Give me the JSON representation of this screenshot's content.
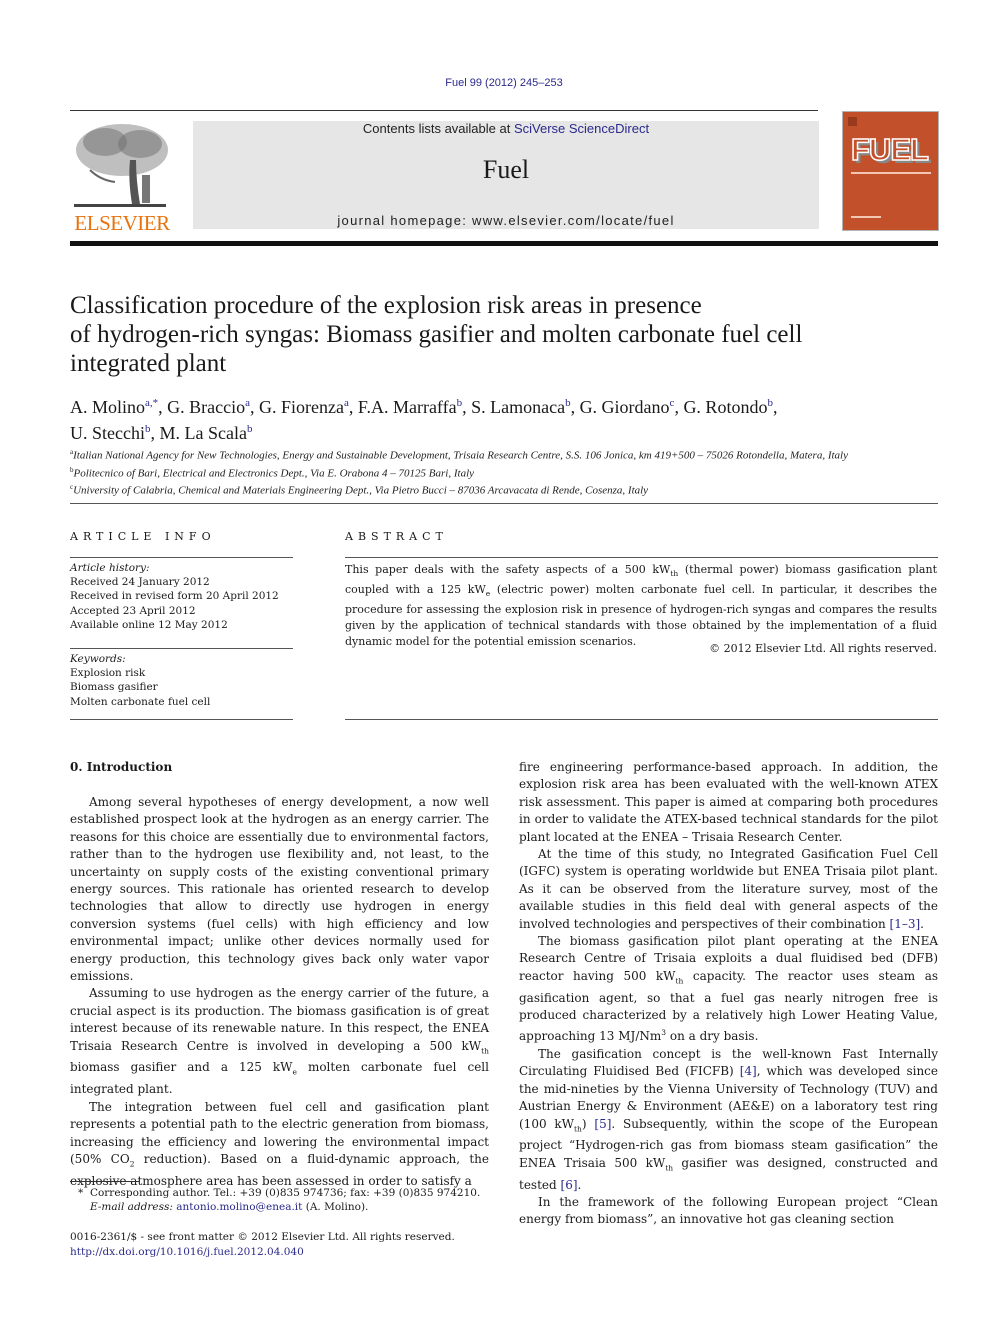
{
  "header": {
    "journal_reference": "Fuel 99 (2012) 245–253",
    "contents_prefix": "Contents lists available at ",
    "contents_link": "SciVerse ScienceDirect",
    "journal_name": "Fuel",
    "homepage": "journal homepage: www.elsevier.com/locate/fuel",
    "publisher_logo_text": "ELSEVIER",
    "cover_title": "FUEL",
    "colors": {
      "elsevier_orange": "#e8730e",
      "cover_orange": "#c2502a",
      "link_blue": "#2a2a8c",
      "masthead_gray": "#e6e6e6"
    }
  },
  "article": {
    "title_lines": [
      "Classification procedure of the explosion risk areas in presence",
      "of hydrogen-rich syngas: Biomass gasifier and molten carbonate fuel cell",
      "integrated plant"
    ],
    "authors": [
      {
        "name": "A. Molino",
        "aff": "a,*"
      },
      {
        "name": "G. Braccio",
        "aff": "a"
      },
      {
        "name": "G. Fiorenza",
        "aff": "a"
      },
      {
        "name": "F.A. Marraffa",
        "aff": "b"
      },
      {
        "name": "S. Lamonaca",
        "aff": "b"
      },
      {
        "name": "G. Giordano",
        "aff": "c"
      },
      {
        "name": "G. Rotondo",
        "aff": "b"
      },
      {
        "name": "U. Stecchi",
        "aff": "b"
      },
      {
        "name": "M. La Scala",
        "aff": "b"
      }
    ],
    "affiliations": [
      {
        "mark": "a",
        "text": "Italian National Agency for New Technologies, Energy and Sustainable Development, Trisaia Research Centre, S.S. 106 Jonica, km 419+500 – 75026 Rotondella, Matera, Italy"
      },
      {
        "mark": "b",
        "text": "Politecnico of Bari, Electrical and Electronics Dept., Via E. Orabona 4 – 70125 Bari, Italy"
      },
      {
        "mark": "c",
        "text": "University of Calabria, Chemical and Materials Engineering Dept., Via Pietro Bucci – 87036 Arcavacata di Rende, Cosenza, Italy"
      }
    ]
  },
  "article_info": {
    "heading": "ARTICLE INFO",
    "history_label": "Article history:",
    "history": [
      "Received 24 January 2012",
      "Received in revised form 20 April 2012",
      "Accepted 23 April 2012",
      "Available online 12 May 2012"
    ],
    "keywords_label": "Keywords:",
    "keywords": [
      "Explosion risk",
      "Biomass gasifier",
      "Molten carbonate fuel cell"
    ]
  },
  "abstract": {
    "heading": "ABSTRACT",
    "t1": "This paper deals with the safety aspects of a 500 kW",
    "s1": "th",
    "t2": " (thermal power) biomass gasification plant coupled with a 125 kW",
    "s2": "e",
    "t3": " (electric power) molten carbonate fuel cell. In particular, it describes the procedure for assessing the explosion risk in presence of hydrogen-rich syngas and compares the results given by the application of technical standards with those obtained by the implementation of a fluid dynamic model for the potential emission scenarios.",
    "copyright": "© 2012 Elsevier Ltd. All rights reserved."
  },
  "body": {
    "section_title": "0. Introduction",
    "left": {
      "p1": "Among several hypotheses of energy development, a now well established prospect look at the hydrogen as an energy carrier. The reasons for this choice are essentially due to environmental factors, rather than to the hydrogen use flexibility and, not least, to the uncertainty on supply costs of the existing conventional primary energy sources. This rationale has oriented research to develop technologies that allow to directly use hydrogen in energy conversion systems (fuel cells) with high efficiency and low environmental impact; unlike other devices normally used for energy production, this technology gives back only water vapor emissions.",
      "p2a": "Assuming to use hydrogen as the energy carrier of the future, a crucial aspect is its production. The biomass gasification is of great interest because of its renewable nature. In this respect, the ENEA Trisaia Research Centre is involved in developing a 500 kW",
      "p2s1": "th",
      "p2b": " biomass gasifier and a 125 kW",
      "p2s2": "e",
      "p2c": " molten carbonate fuel cell integrated plant.",
      "p3a": "The integration between fuel cell and gasification plant represents a potential path to the electric generation from biomass, increasing the efficiency and lowering the environmental impact (50% CO",
      "p3s1": "2",
      "p3b": " reduction). Based on a fluid-dynamic approach, the explosive atmosphere area has been assessed in order to satisfy a"
    },
    "right": {
      "p1": "fire engineering performance-based approach. In addition, the explosion risk area has been evaluated with the well-known ATEX risk assessment. This paper is aimed at comparing both procedures in order to validate the ATEX-based technical standards for the pilot plant located at the ENEA – Trisaia Research Center.",
      "p2a": "At the time of this study, no Integrated Gasification Fuel Cell (IGFC) system is operating worldwide but ENEA Trisaia pilot plant. As it can be observed from the literature survey, most of the available studies in this field deal with general aspects of the involved technologies and perspectives of their combination ",
      "p2ref": "[1–3]",
      "p2b": ".",
      "p3a": "The biomass gasification pilot plant operating at the ENEA Research Centre of Trisaia exploits a dual fluidised bed (DFB) reactor having 500 kW",
      "p3s1": "th",
      "p3b": " capacity. The reactor uses steam as gasification agent, so that a fuel gas nearly nitrogen free is produced characterized by a relatively high Lower Heating Value, approaching 13 MJ/Nm",
      "p3sup": "3",
      "p3c": " on a dry basis.",
      "p4a": "The gasification concept is the well-known Fast Internally Circulating Fluidised Bed (FICFB) ",
      "p4ref1": "[4]",
      "p4b": ", which was developed since the mid-nineties by the Vienna University of Technology (TUV) and Austrian Energy & Environment (AE&E) on a laboratory test ring (100 kW",
      "p4s1": "th",
      "p4c": ") ",
      "p4ref2": "[5]",
      "p4d": ". Subsequently, within the scope of the European project “Hydrogen-rich gas from biomass steam gasification” the ENEA Trisaia 500 kW",
      "p4s2": "th",
      "p4e": " gasifier was designed, constructed and tested ",
      "p4ref3": "[6]",
      "p4f": ".",
      "p5": "In the framework of the following European project “Clean energy from biomass”, an innovative hot gas cleaning section"
    }
  },
  "footnotes": {
    "star": "*",
    "corresponding": "Corresponding author. Tel.: +39 (0)835 974736; fax: +39 (0)835 974210.",
    "email_label": "E-mail address:",
    "email": "antonio.molino@enea.it",
    "email_suffix": " (A. Molino).",
    "issn_line": "0016-2361/$ - see front matter © 2012 Elsevier Ltd. All rights reserved.",
    "doi": "http://dx.doi.org/10.1016/j.fuel.2012.04.040"
  }
}
